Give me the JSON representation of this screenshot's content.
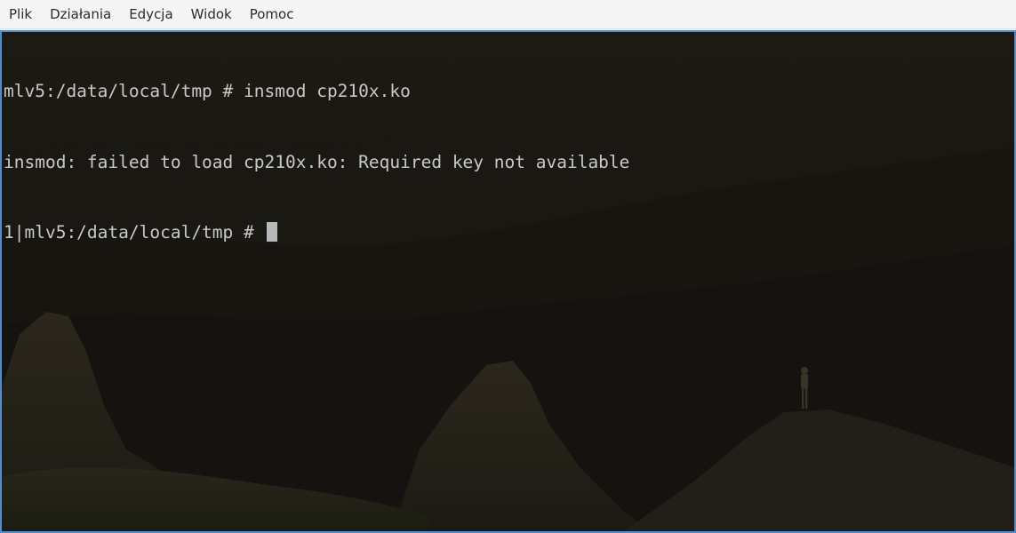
{
  "menubar": {
    "items": [
      "Plik",
      "Działania",
      "Edycja",
      "Widok",
      "Pomoc"
    ]
  },
  "terminal": {
    "lines": [
      "mlv5:/data/local/tmp # insmod cp210x.ko",
      "insmod: failed to load cp210x.ko: Required key not available"
    ],
    "prompt": "1|mlv5:/data/local/tmp # "
  },
  "colors": {
    "focus_border": "#4a8fd6",
    "terminal_text": "#c8c8c8",
    "menubar_bg": "#f5f5f5"
  }
}
